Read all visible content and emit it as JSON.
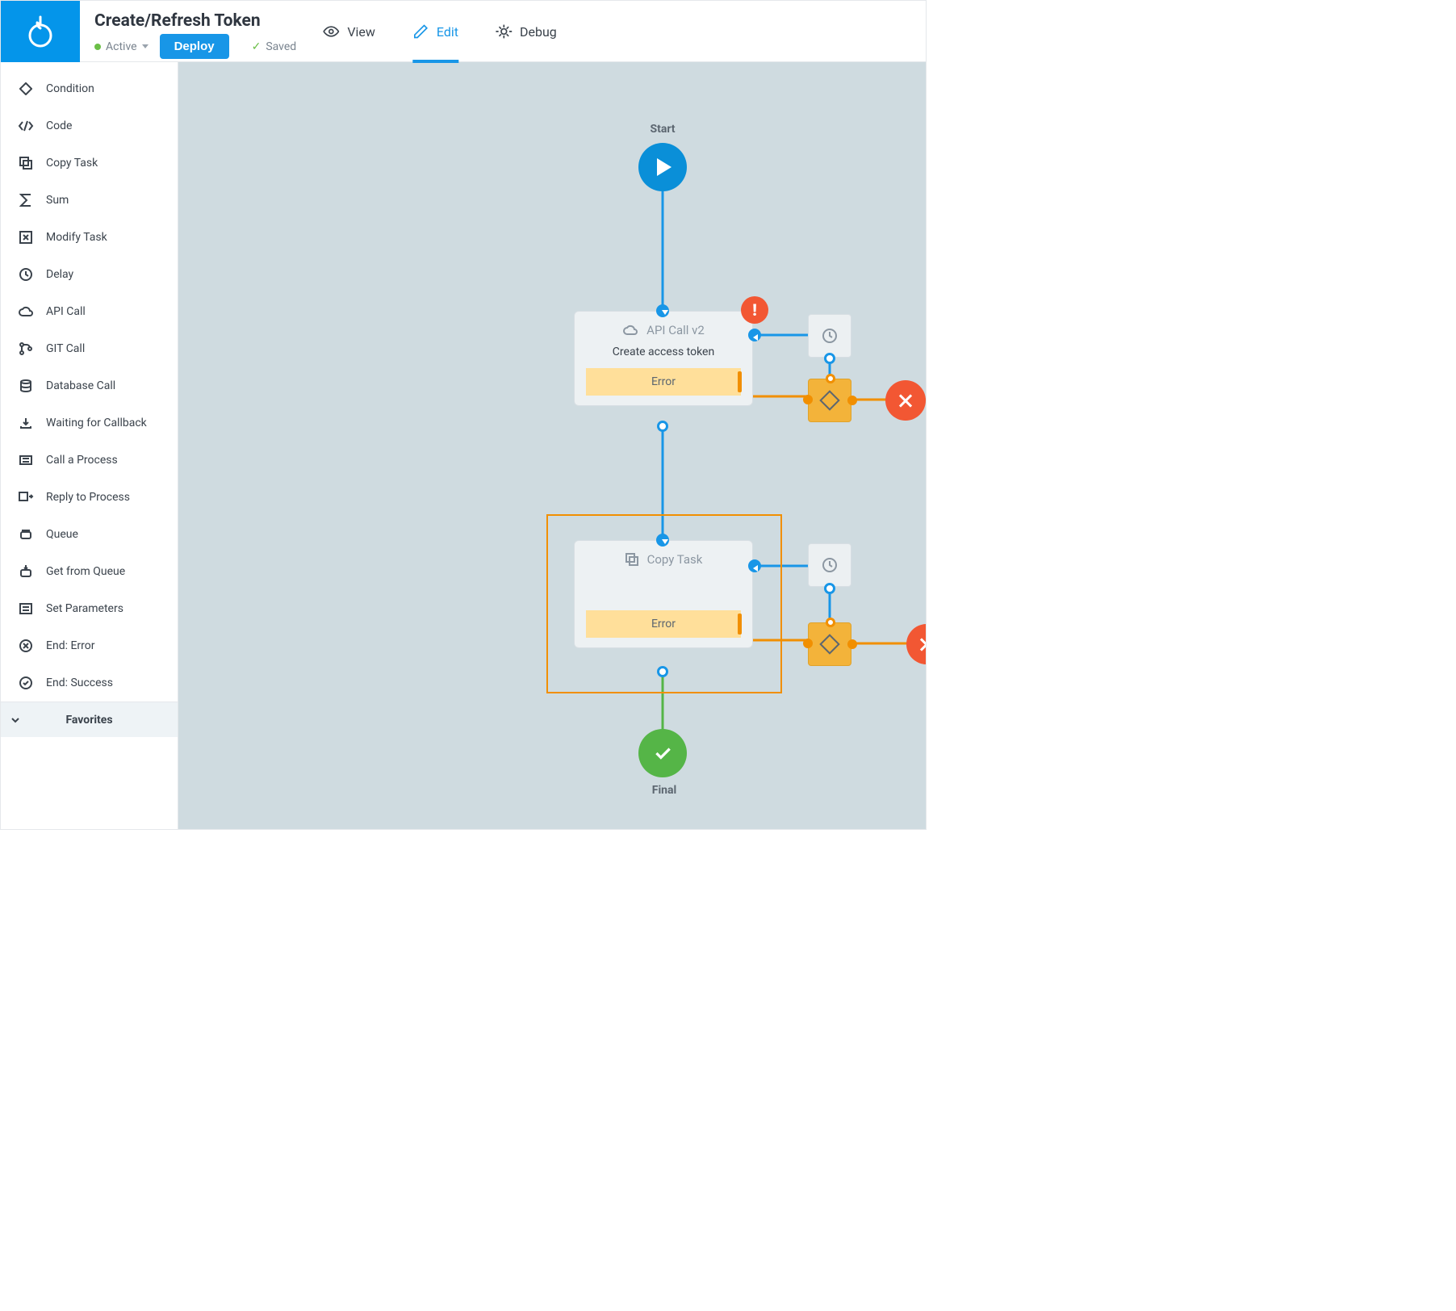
{
  "header": {
    "title": "Create/Refresh Token",
    "status_label": "Active",
    "deploy_label": "Deploy",
    "saved_label": "Saved"
  },
  "tabs": {
    "view": "View",
    "edit": "Edit",
    "debug": "Debug"
  },
  "sidebar": {
    "items": [
      {
        "icon": "diamond",
        "label": "Condition"
      },
      {
        "icon": "code",
        "label": "Code"
      },
      {
        "icon": "copy",
        "label": "Copy Task"
      },
      {
        "icon": "sigma",
        "label": "Sum"
      },
      {
        "icon": "modify",
        "label": "Modify Task"
      },
      {
        "icon": "clock",
        "label": "Delay"
      },
      {
        "icon": "cloud",
        "label": "API Call"
      },
      {
        "icon": "git",
        "label": "GIT Call"
      },
      {
        "icon": "db",
        "label": "Database Call"
      },
      {
        "icon": "download",
        "label": "Waiting for Callback"
      },
      {
        "icon": "proc",
        "label": "Call a Process"
      },
      {
        "icon": "reply",
        "label": "Reply to Process"
      },
      {
        "icon": "queue",
        "label": "Queue"
      },
      {
        "icon": "queue-get",
        "label": "Get from Queue"
      },
      {
        "icon": "params",
        "label": "Set Parameters"
      },
      {
        "icon": "x-circle",
        "label": "End: Error"
      },
      {
        "icon": "check-circle",
        "label": "End: Success"
      }
    ],
    "favorites_label": "Favorites"
  },
  "flow": {
    "start_label": "Start",
    "final_label": "Final",
    "node1": {
      "type": "API Call v2",
      "title": "Create access token",
      "error": "Error"
    },
    "node2": {
      "type": "Copy Task",
      "title": "",
      "error": "Error"
    }
  }
}
